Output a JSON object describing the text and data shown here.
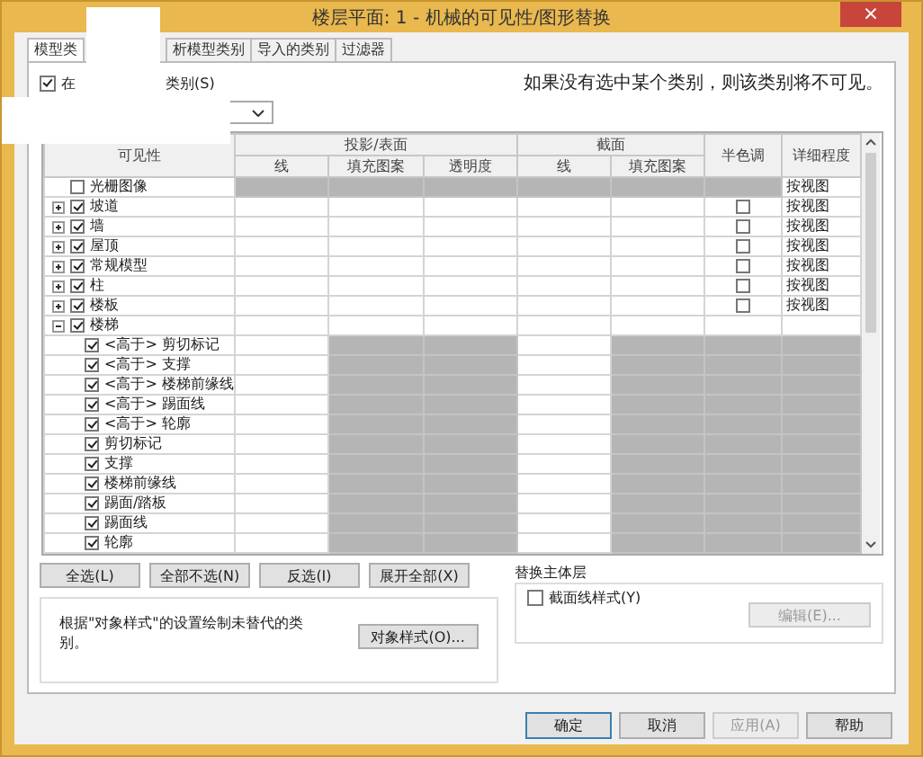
{
  "window": {
    "title": "楼层平面: 1 - 机械的可见性/图形替换",
    "close": "×"
  },
  "tabs": [
    {
      "label": "模型类",
      "selected": true
    },
    {
      "label": "析模型类别",
      "selected": false
    },
    {
      "label": "导入的类别",
      "selected": false
    },
    {
      "label": "过滤器",
      "selected": false
    }
  ],
  "show_checkbox": {
    "checked": true,
    "label_start": "在",
    "label_end": "类别(S)"
  },
  "hint": "如果没有选中某个类别，则该类别将不可见。",
  "table": {
    "headers": {
      "visibility": "可见性",
      "projection": "投影/表面",
      "section": "截面",
      "halftone": "半色调",
      "detail": "详细程度",
      "projection_columns": [
        "线",
        "填充图案",
        "透明度"
      ],
      "section_columns": [
        "线",
        "填充图案"
      ]
    },
    "rows": [
      {
        "label": "光栅图像",
        "checked": false,
        "kind": "raster",
        "detail": "按视图"
      },
      {
        "label": "坡道",
        "checked": true,
        "kind": "category",
        "expanded": false,
        "halftone": false,
        "detail": "按视图"
      },
      {
        "label": "墙",
        "checked": true,
        "kind": "category",
        "expanded": false,
        "halftone": false,
        "detail": "按视图"
      },
      {
        "label": "屋顶",
        "checked": true,
        "kind": "category",
        "expanded": false,
        "halftone": false,
        "detail": "按视图"
      },
      {
        "label": "常规模型",
        "checked": true,
        "kind": "category",
        "expanded": false,
        "halftone": false,
        "detail": "按视图"
      },
      {
        "label": "柱",
        "checked": true,
        "kind": "category",
        "expanded": false,
        "halftone": false,
        "detail": "按视图"
      },
      {
        "label": "楼板",
        "checked": true,
        "kind": "category",
        "expanded": false,
        "halftone": false,
        "detail": "按视图"
      },
      {
        "label": "楼梯",
        "checked": true,
        "kind": "category",
        "expanded": true,
        "children": [
          {
            "label": "<高于> 剪切标记",
            "checked": true,
            "kind": "subcategory"
          },
          {
            "label": "<高于> 支撑",
            "checked": true,
            "kind": "subcategory"
          },
          {
            "label": "<高于> 楼梯前缘线",
            "checked": true,
            "kind": "subcategory"
          },
          {
            "label": "<高于> 踢面线",
            "checked": true,
            "kind": "subcategory"
          },
          {
            "label": "<高于> 轮廓",
            "checked": true,
            "kind": "subcategory"
          },
          {
            "label": "剪切标记",
            "checked": true,
            "kind": "subcategory"
          },
          {
            "label": "支撑",
            "checked": true,
            "kind": "subcategory"
          },
          {
            "label": "楼梯前缘线",
            "checked": true,
            "kind": "subcategory"
          },
          {
            "label": "踢面/踏板",
            "checked": true,
            "kind": "subcategory"
          },
          {
            "label": "踢面线",
            "checked": true,
            "kind": "subcategory"
          },
          {
            "label": "轮廓",
            "checked": true,
            "kind": "subcategory"
          }
        ]
      }
    ]
  },
  "tree_buttons": [
    "全选(L)",
    "全部不选(N)",
    "反选(I)",
    "展开全部(X)"
  ],
  "override_host": {
    "title": "替换主体层",
    "checkbox": {
      "label": "截面线样式(Y)",
      "checked": false
    },
    "edit_button": {
      "label": "编辑(E)...",
      "disabled": true
    }
  },
  "object_styles": {
    "text": "根据\"对象样式\"的设置绘制未替代的类别。",
    "button": "对象样式(O)..."
  },
  "footer_buttons": [
    {
      "label": "确定",
      "disabled": false,
      "default": true
    },
    {
      "label": "取消",
      "disabled": false,
      "default": false
    },
    {
      "label": "应用(A)",
      "disabled": true,
      "default": false
    },
    {
      "label": "帮助",
      "disabled": false,
      "default": false
    }
  ]
}
